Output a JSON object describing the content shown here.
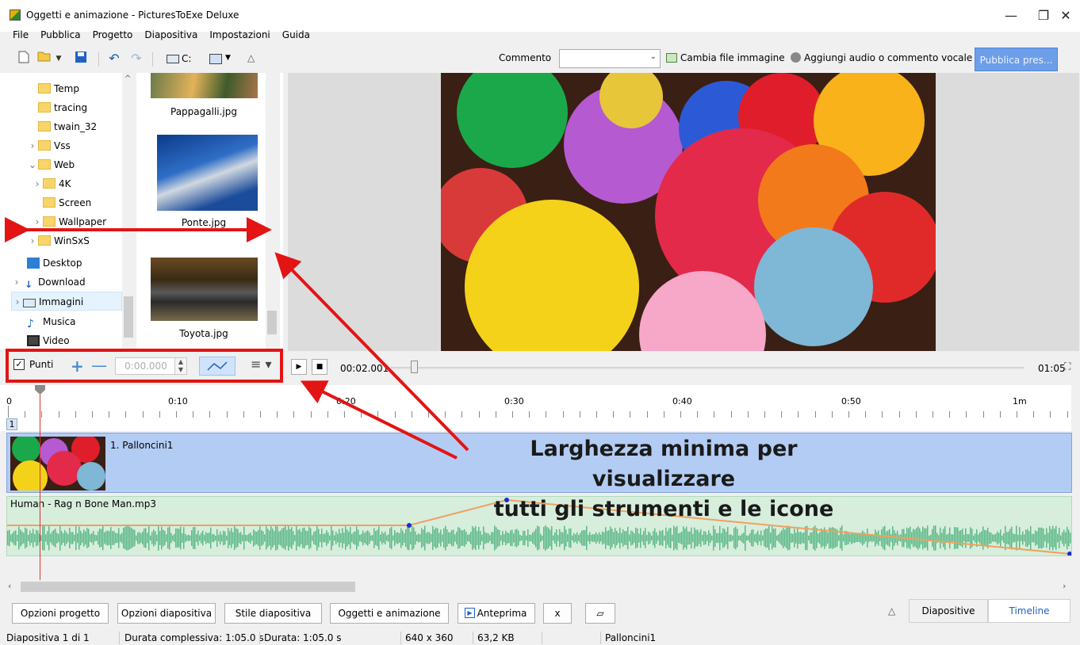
{
  "window": {
    "title": "Oggetti e animazione - PicturesToExe Deluxe"
  },
  "menu": [
    "File",
    "Pubblica",
    "Progetto",
    "Diapositiva",
    "Impostazioni",
    "Guida"
  ],
  "toolbar": {
    "drive_label": "C:",
    "commento_label": "Commento",
    "commento_value": "",
    "change_image_label": "Cambia file immagine",
    "add_audio_label": "Aggiungi audio o commento vocale",
    "publish_label": "Pubblica pres..."
  },
  "folder_tree": [
    {
      "label": "Temp",
      "icon": "folder-icon",
      "expander": ""
    },
    {
      "label": "tracing",
      "icon": "folder-icon",
      "expander": ""
    },
    {
      "label": "twain_32",
      "icon": "folder-icon",
      "expander": ""
    },
    {
      "label": "Vss",
      "icon": "folder-icon",
      "expander": "›"
    },
    {
      "label": "Web",
      "icon": "folder-icon",
      "expander": "⌄"
    },
    {
      "label": "4K",
      "icon": "folder-icon",
      "expander": "›"
    },
    {
      "label": "Screen",
      "icon": "folder-icon",
      "expander": ""
    },
    {
      "label": "Wallpaper",
      "icon": "folder-icon",
      "expander": "›"
    },
    {
      "label": "WinSxS",
      "icon": "folder-icon",
      "expander": "›"
    },
    {
      "label": "Desktop",
      "icon": "desktop-icon",
      "expander": ""
    },
    {
      "label": "Download",
      "icon": "download-icon",
      "expander": "›"
    },
    {
      "label": "Immagini",
      "icon": "pictures-icon",
      "expander": "›"
    },
    {
      "label": "Musica",
      "icon": "music-icon",
      "expander": ""
    },
    {
      "label": "Video",
      "icon": "video-icon",
      "expander": ""
    }
  ],
  "thumbnails": [
    "Pappagalli.jpg",
    "Ponte.jpg",
    "Toyota.jpg"
  ],
  "keyframe_toolbar": {
    "checked": true,
    "label": "Punti",
    "time_value": "0:00.000"
  },
  "player": {
    "current_time": "00:02.001",
    "total_time": "01:05",
    "progress": 0.031
  },
  "timeline": {
    "ruler_labels": [
      "0",
      "0:10",
      "0:20",
      "0:30",
      "0:40",
      "0:50",
      "1m"
    ],
    "slide_number": "1",
    "slide_label": "1. Palloncini1",
    "audio_label": "Human - Rag n Bone Man.mp3"
  },
  "annotation": {
    "line1": "Larghezza minima per visualizzare",
    "line2": "tutti gli strumenti e le icone"
  },
  "bottom_buttons": [
    "Opzioni progetto",
    "Opzioni diapositiva",
    "Stile diapositiva",
    "Oggetti e animazione",
    "Anteprima",
    "x"
  ],
  "tabs": {
    "slides": "Diapositive",
    "timeline": "Timeline"
  },
  "status": {
    "slide_pos": "Diapositiva 1 di 1",
    "total_duration": "Durata complessiva: 1:05.0 s",
    "duration": "Durata: 1:05.0 s",
    "resolution": "640 x 360",
    "size": "63,2 KB",
    "name": "Palloncini1"
  },
  "colors": {
    "accent": "#6d9ee8",
    "annotation_red": "#e31414",
    "slide_track": "#b3ccf4",
    "audio_track": "#d7eedc",
    "waveform": "#5cb888"
  }
}
